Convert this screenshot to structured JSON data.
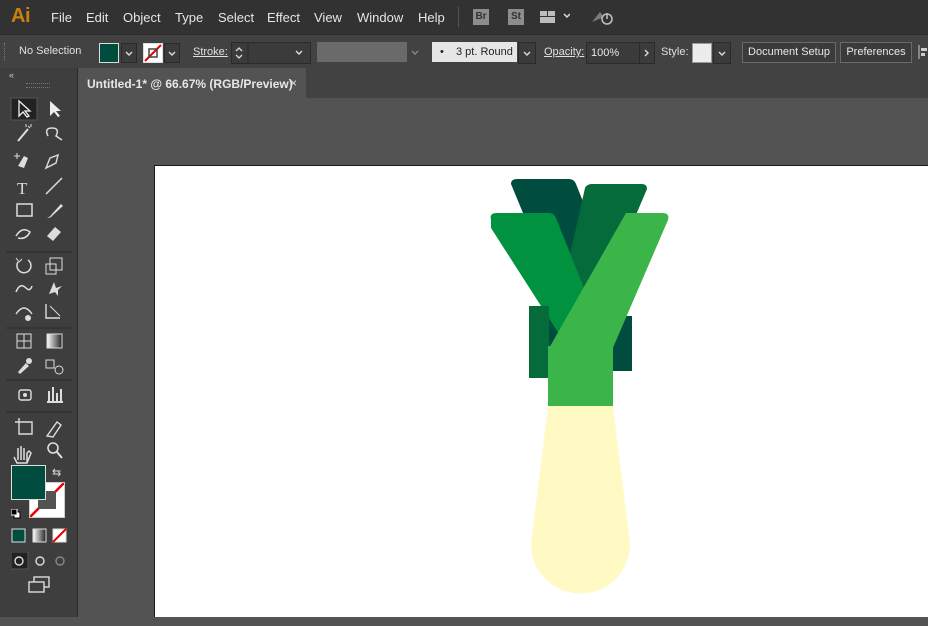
{
  "app": {
    "logo": "Ai"
  },
  "menu": [
    "File",
    "Edit",
    "Object",
    "Type",
    "Select",
    "Effect",
    "View",
    "Window",
    "Help"
  ],
  "bridge": {
    "br": "Br",
    "st": "St"
  },
  "control": {
    "selection": "No Selection",
    "stroke_label": "Stroke:",
    "brush": "3 pt. Round",
    "opacity_label": "Opacity:",
    "opacity_value": "100%",
    "style_label": "Style:",
    "doc_setup": "Document Setup",
    "preferences": "Preferences"
  },
  "tab": {
    "title": "Untitled-1* @ 66.67% (RGB/Preview)",
    "close": "×"
  },
  "colors": {
    "fill": "#004d40",
    "dark": "#004d40",
    "mid": "#066b3a",
    "green": "#00923f",
    "light": "#3bb54a",
    "bulb": "#fff9c4"
  },
  "tools": [
    "selection-tool",
    "direct-selection-tool",
    "magic-wand-tool",
    "lasso-tool",
    "pen-tool",
    "curvature-tool",
    "type-tool",
    "line-tool",
    "rectangle-tool",
    "paintbrush-tool",
    "shaper-tool",
    "eraser-tool",
    "rotate-tool",
    "scale-tool",
    "warp-tool",
    "puppet-warp-tool",
    "free-transform-tool",
    "shape-builder-tool",
    "perspective-grid-tool",
    "perspective-selection-tool",
    "mesh-tool",
    "gradient-tool",
    "eyedropper-tool",
    "blend-tool",
    "symbol-sprayer-tool",
    "column-graph-tool",
    "artboard-tool",
    "slice-tool",
    "hand-tool",
    "zoom-tool"
  ]
}
